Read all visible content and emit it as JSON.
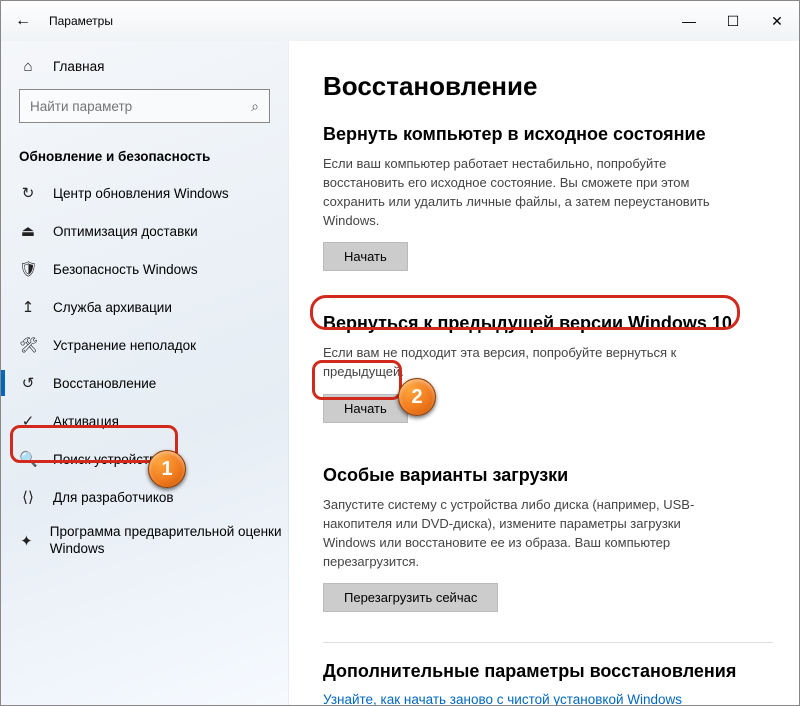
{
  "window": {
    "title": "Параметры",
    "back_icon": "←",
    "min_icon": "—",
    "max_icon": "☐",
    "close_icon": "✕"
  },
  "sidebar": {
    "home_label": "Главная",
    "search_placeholder": "Найти параметр",
    "category": "Обновление и безопасность",
    "items": [
      {
        "label": "Центр обновления Windows",
        "icon": "↻"
      },
      {
        "label": "Оптимизация доставки",
        "icon": "⏏"
      },
      {
        "label": "Безопасность Windows",
        "icon": "🛡"
      },
      {
        "label": "Служба архивации",
        "icon": "↥"
      },
      {
        "label": "Устранение неполадок",
        "icon": "🛠"
      },
      {
        "label": "Восстановление",
        "icon": "↺"
      },
      {
        "label": "Активация",
        "icon": "✓"
      },
      {
        "label": "Поиск устройства",
        "icon": "🔍"
      },
      {
        "label": "Для разработчиков",
        "icon": "⟨⟩"
      },
      {
        "label": "Программа предварительной оценки Windows",
        "icon": "✦"
      }
    ]
  },
  "content": {
    "page_title": "Восстановление",
    "reset": {
      "heading": "Вернуть компьютер в исходное состояние",
      "desc": "Если ваш компьютер работает нестабильно, попробуйте восстановить его исходное состояние. Вы сможете при этом сохранить или удалить личные файлы, а затем переустановить Windows.",
      "button": "Начать"
    },
    "goback": {
      "heading": "Вернуться к предыдущей версии Windows 10",
      "desc": "Если вам не подходит эта версия, попробуйте вернуться к предыдущей.",
      "button": "Начать"
    },
    "advboot": {
      "heading": "Особые варианты загрузки",
      "desc": "Запустите систему с устройства либо диска (например, USB-накопителя или DVD-диска), измените параметры загрузки Windows или восстановите ее из образа. Ваш компьютер перезагрузится.",
      "button": "Перезагрузить сейчас"
    },
    "more": {
      "heading": "Дополнительные параметры восстановления",
      "link": "Узнайте, как начать заново с чистой установкой Windows"
    }
  },
  "annotations": {
    "badge1": "1",
    "badge2": "2"
  }
}
